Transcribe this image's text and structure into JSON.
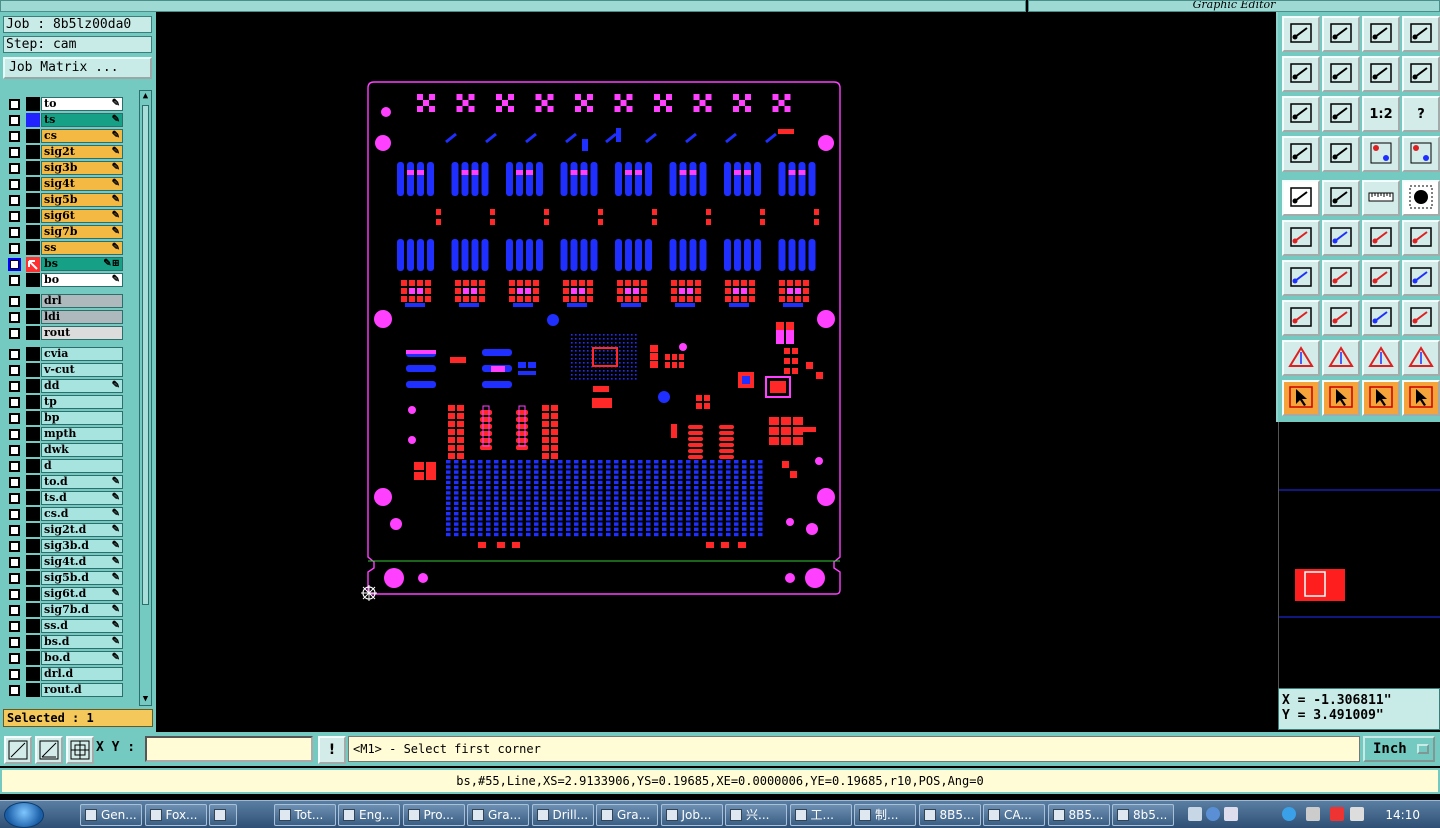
{
  "window": {
    "right_title": "Graphic Editor"
  },
  "job": {
    "name": "Job : 8b5lz00da0",
    "step": "Step: cam"
  },
  "job_matrix_label": "Job Matrix ...",
  "layers": [
    {
      "name": "to",
      "color": "#ffffff",
      "flag": "✎",
      "stat": "#000000"
    },
    {
      "name": "ts",
      "color": "#16a085",
      "flag": "✎",
      "stat": "#2222ff"
    },
    {
      "name": "cs",
      "color": "#f4b942",
      "flag": "✎",
      "stat": "#000000"
    },
    {
      "name": "sig2t",
      "color": "#f4b942",
      "flag": "✎",
      "stat": "#000000"
    },
    {
      "name": "sig3b",
      "color": "#f4b942",
      "flag": "✎",
      "stat": "#000000"
    },
    {
      "name": "sig4t",
      "color": "#f4b942",
      "flag": "✎",
      "stat": "#000000"
    },
    {
      "name": "sig5b",
      "color": "#f4b942",
      "flag": "✎",
      "stat": "#000000"
    },
    {
      "name": "sig6t",
      "color": "#f4b942",
      "flag": "✎",
      "stat": "#000000"
    },
    {
      "name": "sig7b",
      "color": "#f4b942",
      "flag": "✎",
      "stat": "#000000"
    },
    {
      "name": "ss",
      "color": "#f4b942",
      "flag": "✎",
      "stat": "#000000"
    },
    {
      "name": "bs",
      "color": "#16a085",
      "flag": "✎⊞",
      "stat": "#ff3030",
      "work": true
    },
    {
      "name": "bo",
      "color": "#ffffff",
      "flag": "✎",
      "stat": "#000000"
    },
    {
      "name": "drl",
      "color": "#aeb9bd",
      "flag": "",
      "stat": "#000000",
      "gap": true
    },
    {
      "name": "ldi",
      "color": "#aeb9bd",
      "flag": "",
      "stat": "#000000"
    },
    {
      "name": "rout",
      "color": "#dcdcdc",
      "flag": "",
      "stat": "#000000"
    },
    {
      "name": "cvia",
      "color": "#a7e3df",
      "flag": "",
      "stat": "#000000",
      "gap": true
    },
    {
      "name": "v-cut",
      "color": "#a7e3df",
      "flag": "",
      "stat": "#000000"
    },
    {
      "name": "dd",
      "color": "#a7e3df",
      "flag": "✎",
      "stat": "#000000"
    },
    {
      "name": "tp",
      "color": "#a7e3df",
      "flag": "",
      "stat": "#000000"
    },
    {
      "name": "bp",
      "color": "#a7e3df",
      "flag": "",
      "stat": "#000000"
    },
    {
      "name": "mpth",
      "color": "#a7e3df",
      "flag": "",
      "stat": "#000000"
    },
    {
      "name": "dwk",
      "color": "#a7e3df",
      "flag": "",
      "stat": "#000000"
    },
    {
      "name": "d",
      "color": "#a7e3df",
      "flag": "",
      "stat": "#000000"
    },
    {
      "name": "to.d",
      "color": "#a7e3df",
      "flag": "✎",
      "stat": "#000000"
    },
    {
      "name": "ts.d",
      "color": "#a7e3df",
      "flag": "✎",
      "stat": "#000000"
    },
    {
      "name": "cs.d",
      "color": "#a7e3df",
      "flag": "✎",
      "stat": "#000000"
    },
    {
      "name": "sig2t.d",
      "color": "#a7e3df",
      "flag": "✎",
      "stat": "#000000"
    },
    {
      "name": "sig3b.d",
      "color": "#a7e3df",
      "flag": "✎",
      "stat": "#000000"
    },
    {
      "name": "sig4t.d",
      "color": "#a7e3df",
      "flag": "✎",
      "stat": "#000000"
    },
    {
      "name": "sig5b.d",
      "color": "#a7e3df",
      "flag": "✎",
      "stat": "#000000"
    },
    {
      "name": "sig6t.d",
      "color": "#a7e3df",
      "flag": "✎",
      "stat": "#000000"
    },
    {
      "name": "sig7b.d",
      "color": "#a7e3df",
      "flag": "✎",
      "stat": "#000000"
    },
    {
      "name": "ss.d",
      "color": "#a7e3df",
      "flag": "✎",
      "stat": "#000000"
    },
    {
      "name": "bs.d",
      "color": "#a7e3df",
      "flag": "✎",
      "stat": "#000000"
    },
    {
      "name": "bo.d",
      "color": "#a7e3df",
      "flag": "✎",
      "stat": "#000000"
    },
    {
      "name": "drl.d",
      "color": "#a7e3df",
      "flag": "",
      "stat": "#000000"
    },
    {
      "name": "rout.d",
      "color": "#a7e3df",
      "flag": "",
      "stat": "#000000"
    }
  ],
  "selected_label": "Selected : 1",
  "coords": {
    "x": "X = -1.306811\"",
    "y": "Y = 3.491009\""
  },
  "cmd": {
    "xy_label": "X Y :",
    "xy_value": "",
    "prompt": "<M1> - Select first corner",
    "unit": "Inch"
  },
  "status_line": "bs,#55,Line,XS=2.9133906,YS=0.19685,XE=0.0000006,YE=0.19685,r10,POS,Ang=0",
  "taskbar": {
    "tasks": [
      "Gen...",
      "Fox...",
      "",
      "Tot...",
      "Eng...",
      "Pro...",
      "Gra...",
      "Drill...",
      "Gra...",
      "Job...",
      "兴...",
      "工...",
      "制...",
      "8B5...",
      "CA...",
      "8B5...",
      "8b5..."
    ],
    "clock": "14:10"
  },
  "colors": {
    "top_layer": "#ff2828",
    "bottom_layer": "#1f2fff",
    "outline": "#ff40ff",
    "panel": "#74c9c1"
  },
  "toolbar_icons": [
    "home-up-icon",
    "home-down-icon",
    "house-icon",
    "window-icon",
    "pan-left-icon",
    "pan-right-icon",
    "undo-zoom-icon",
    "redo-zoom-icon",
    "fit-icon",
    "center-icon",
    "scale-1-2-icon",
    "help-icon",
    "settings-icon",
    "snap-icon",
    "layer-red-icon",
    "layer-swap-icon",
    "select-box-icon",
    "transform-icon",
    "ruler-icon",
    "dot-icon",
    "connect-icon",
    "delete-icon",
    "line-icon",
    "pin-icon",
    "angle-icon",
    "slash-icon",
    "rotate-icon",
    "mirror-icon",
    "node-icon",
    "minus-icon",
    "measure-icon",
    "group-icon",
    "triangle-a-icon",
    "triangle-b-icon",
    "triangle-c-icon",
    "triangle-d-icon",
    "pointer-icon",
    "pointer-select-icon",
    "pointer-net-icon",
    "route-icon"
  ]
}
